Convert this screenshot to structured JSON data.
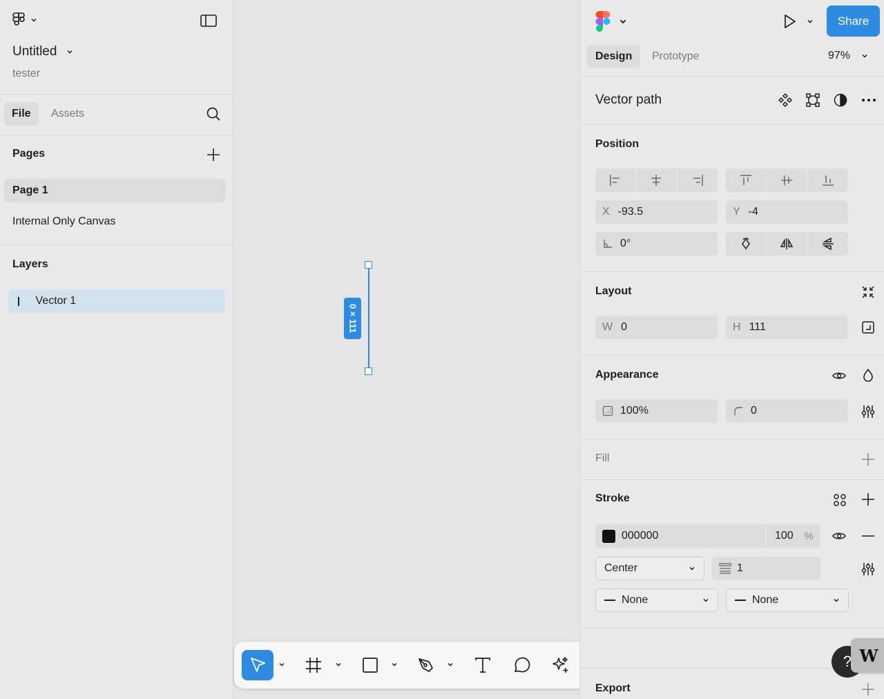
{
  "app": {
    "file_name": "Untitled",
    "owner": "tester"
  },
  "left_panel": {
    "tabs": [
      "File",
      "Assets"
    ],
    "pages_heading": "Pages",
    "pages": [
      "Page 1",
      "Internal Only Canvas"
    ],
    "selected_page": "Page 1",
    "layers_heading": "Layers",
    "layers": [
      {
        "name": "Vector 1",
        "selected": true
      }
    ]
  },
  "canvas": {
    "dimension_badge": "0 × 111",
    "selection_color": "#2d8ce1"
  },
  "toolbar": {
    "tools": [
      "move-tool",
      "frame-tool",
      "shape-tool",
      "pen-tool",
      "text-tool",
      "comment-tool",
      "actions-tool",
      "dev-mode-toggle"
    ],
    "active_tool": "move-tool"
  },
  "right_panel": {
    "share_label": "Share",
    "tabs": [
      "Design",
      "Prototype"
    ],
    "active_tab": "Design",
    "zoom": "97%",
    "selection_title": "Vector path",
    "position": {
      "title": "Position",
      "x_label": "X",
      "x": "-93.5",
      "y_label": "Y",
      "y": "-4",
      "rotation": "0°"
    },
    "layout": {
      "title": "Layout",
      "w_label": "W",
      "w": "0",
      "h_label": "H",
      "h": "111"
    },
    "appearance": {
      "title": "Appearance",
      "opacity": "100%",
      "corner_radius": "0"
    },
    "fill": {
      "title": "Fill"
    },
    "stroke": {
      "title": "Stroke",
      "color_hex": "000000",
      "color_swatch": "#111111",
      "opacity": "100",
      "opacity_unit": "%",
      "position": "Center",
      "weight": "1",
      "start_cap": "None",
      "end_cap": "None"
    },
    "export": {
      "title": "Export"
    },
    "accent_color": "#2d8ce1"
  }
}
